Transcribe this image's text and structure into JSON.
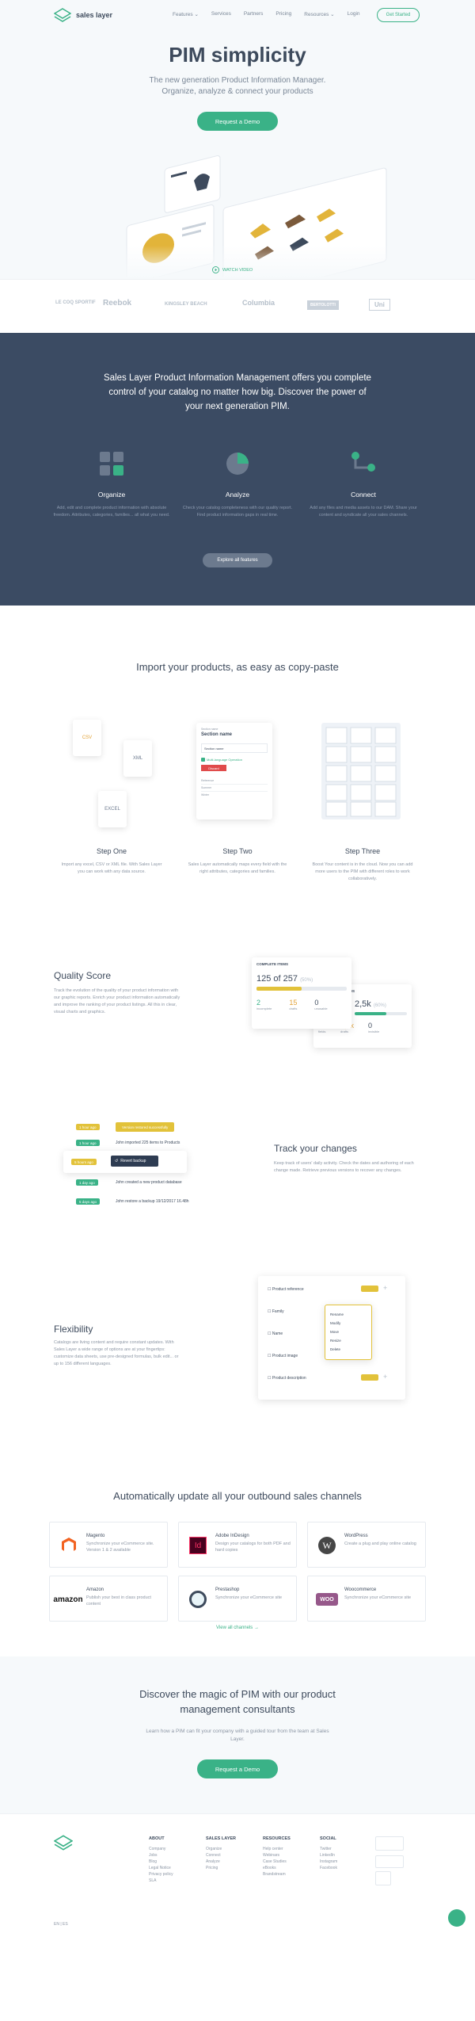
{
  "brand": {
    "name": "sales layer",
    "accent": "#3ab287",
    "dark": "#3b4b63"
  },
  "nav": {
    "items": [
      "Features ⌄",
      "Services",
      "Partners",
      "Pricing",
      "Resources ⌄",
      "Login"
    ],
    "cta": "Get Started"
  },
  "hero": {
    "title": "PIM simplicity",
    "subtitle_line1": "The new generation Product Information Manager.",
    "subtitle_line2": "Organize, analyze & connect your products",
    "cta": "Request a Demo",
    "video": "WATCH VIDEO"
  },
  "logos": [
    "LE COQ SPORTIF",
    "Reebok",
    "KINGSLEY BEACH",
    "Columbia",
    "BERTOLOTTI",
    "Uni"
  ],
  "dark": {
    "lead": "Sales Layer Product Information Management offers you complete control of your catalog no matter how big. Discover the power of your next generation PIM.",
    "features": [
      {
        "title": "Organize",
        "desc": "Add, edit and complete product information with absolute freedom. Attributes, categories, families... all what you need."
      },
      {
        "title": "Analyze",
        "desc": "Check your catalog completeness with our quality report. Find product information gaps in real time."
      },
      {
        "title": "Connect",
        "desc": "Add any files and media assets to our DAM. Share your content and syndicate all your sales channels."
      }
    ],
    "cta": "Explore all features"
  },
  "import": {
    "title": "Import your products, as easy as copy-paste",
    "files": [
      "CSV",
      "XML",
      "EXCEL"
    ],
    "mock": {
      "section_label": "Section name",
      "title": "Section name",
      "multi": "Multi-language Operation",
      "delete": "Discard",
      "fields": [
        "Section name",
        "Reference",
        "Summer",
        "Winter"
      ]
    },
    "steps": [
      {
        "title": "Step One",
        "desc": "Import any excel, CSV or XML file. With Sales Layer you can work with any data source."
      },
      {
        "title": "Step Two",
        "desc": "Sales Layer automatically maps every field with the right attributes, categories and families."
      },
      {
        "title": "Step Three",
        "desc": "Boost Your content is in the cloud. Now you can add more users to the PIM with different roles to work collaboratively."
      }
    ]
  },
  "quality": {
    "title": "Quality Score",
    "desc": "Track the evolution of the quality of your product information with our graphic reports. Enrich your product information automatically and improve the ranking of your product listings. All this in clear, visual charts and graphics.",
    "card1": {
      "label": "COMPLETE ITEMS",
      "value": "125 of 257",
      "pct": "(50%)",
      "fill": 0.5,
      "stats": [
        {
          "n": "2",
          "l": "incomplete"
        },
        {
          "n": "15",
          "l": "drafts"
        },
        {
          "n": "0",
          "l": "unusable"
        }
      ]
    },
    "card2": {
      "label": "FIELDS",
      "value": "2,5k",
      "pct": "(60%)",
      "fill": 0.6,
      "stats": [
        {
          "n": "10",
          "l": "fields"
        },
        {
          "n": "1,7k",
          "l": "drafts"
        },
        {
          "n": "0",
          "l": "invisible"
        }
      ]
    }
  },
  "track": {
    "title": "Track your changes",
    "desc": "Keep track of users' daily activity. Check the dates and authoring of each change made. Retrieve previous versions to recover any changes.",
    "rows": [
      {
        "tag": "1 hour ago",
        "text": "John imported 225 items to Products"
      },
      {
        "tag": "5 hours ago",
        "text": "Revert backup"
      },
      {
        "tag": "1 day ago",
        "text": "John created a new product database"
      },
      {
        "tag": "5 days ago",
        "text": "John restore a backup 19/12/2017 16.48h"
      }
    ],
    "pending": "Version restored successfully"
  },
  "flexibility": {
    "title": "Flexibility",
    "desc": "Catalogs are living content and require constant updates. With Sales Layer a wide range of options are at your fingertips: customize data sheets, use pre-designed formulas, bulk edit... or up to 156 different languages.",
    "fields": [
      "Product reference",
      "Family",
      "Name",
      "Product image",
      "Product description"
    ],
    "menu": [
      "Rename",
      "Modify",
      "Move",
      "Resize",
      "Delete"
    ]
  },
  "channels": {
    "title": "Automatically update all your outbound sales channels",
    "items": [
      {
        "name": "Magento",
        "desc": "Synchronize your eCommerce site. Version 1 & 2 available"
      },
      {
        "name": "Adobe InDesign",
        "desc": "Design your catalogs for both PDF and hard copies"
      },
      {
        "name": "WordPress",
        "desc": "Create a plug and play online catalog"
      },
      {
        "name": "Amazon",
        "desc": "Publish your best in class product content"
      },
      {
        "name": "Prestashop",
        "desc": "Synchronize your eCommerce site"
      },
      {
        "name": "Woocommerce",
        "desc": "Synchronize your eCommerce site"
      }
    ],
    "view_all": "View all channels  →"
  },
  "magic": {
    "title": "Discover the magic of PIM with our product management consultants",
    "desc": "Learn how a PIM can fit your company with a guided tour from the team at Sales Layer.",
    "cta": "Request a Demo"
  },
  "footer": {
    "columns": [
      {
        "title": "ABOUT",
        "links": [
          "Company",
          "Jobs",
          "Blog",
          "Legal Notice",
          "Privacy policy",
          "SLA"
        ]
      },
      {
        "title": "SALES LAYER",
        "links": [
          "Organize",
          "Connect",
          "Analyze",
          "Pricing"
        ]
      },
      {
        "title": "RESOURCES",
        "links": [
          "Help center",
          "Webinars",
          "Case Studies",
          "eBooks",
          "Brandstream"
        ]
      },
      {
        "title": "SOCIAL",
        "links": [
          "Twitter",
          "LinkedIn",
          "Instagram",
          "Facebook"
        ]
      }
    ],
    "lang": "EN  |  ES"
  }
}
